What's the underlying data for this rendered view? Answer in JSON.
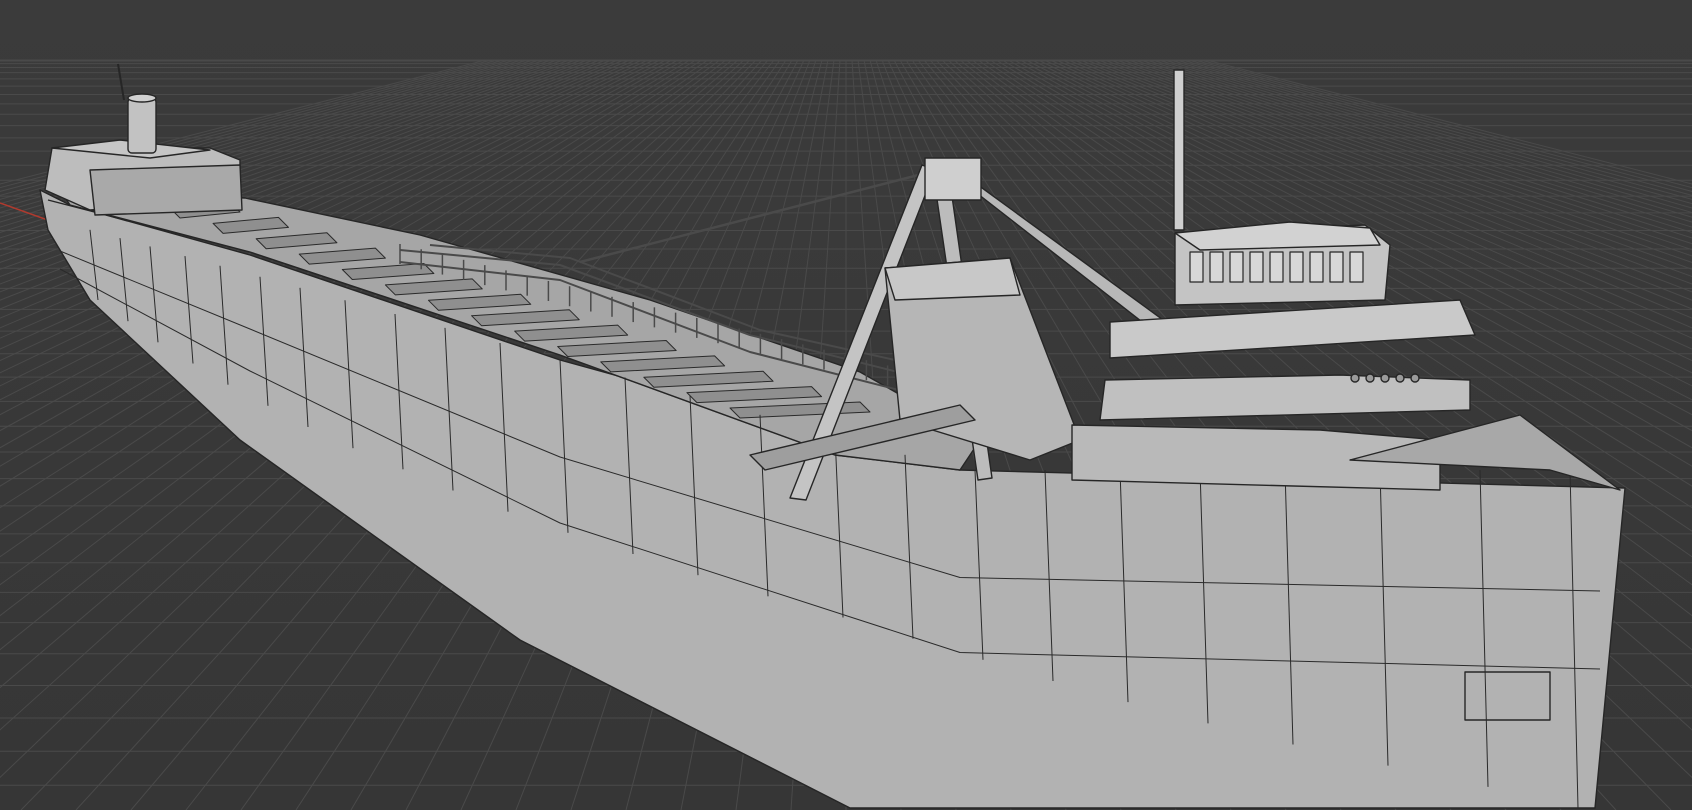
{
  "viewport": {
    "mode": "3D viewport",
    "shading": "solid",
    "background_color": "#393939",
    "grid_color": "#4a4a4a",
    "x_axis_color": "#c0392b",
    "model_color": "#b3b3b3",
    "edge_color": "#2a2a2a"
  },
  "scene": {
    "object": "lake-freighter-hull-model",
    "visible_parts": [
      "hull",
      "aft-superstructure",
      "aft-smokestack",
      "cargo-hatch-deck",
      "deck-railing",
      "unloading-boom-a-frame",
      "forward-pilothouse",
      "forward-mast"
    ]
  }
}
